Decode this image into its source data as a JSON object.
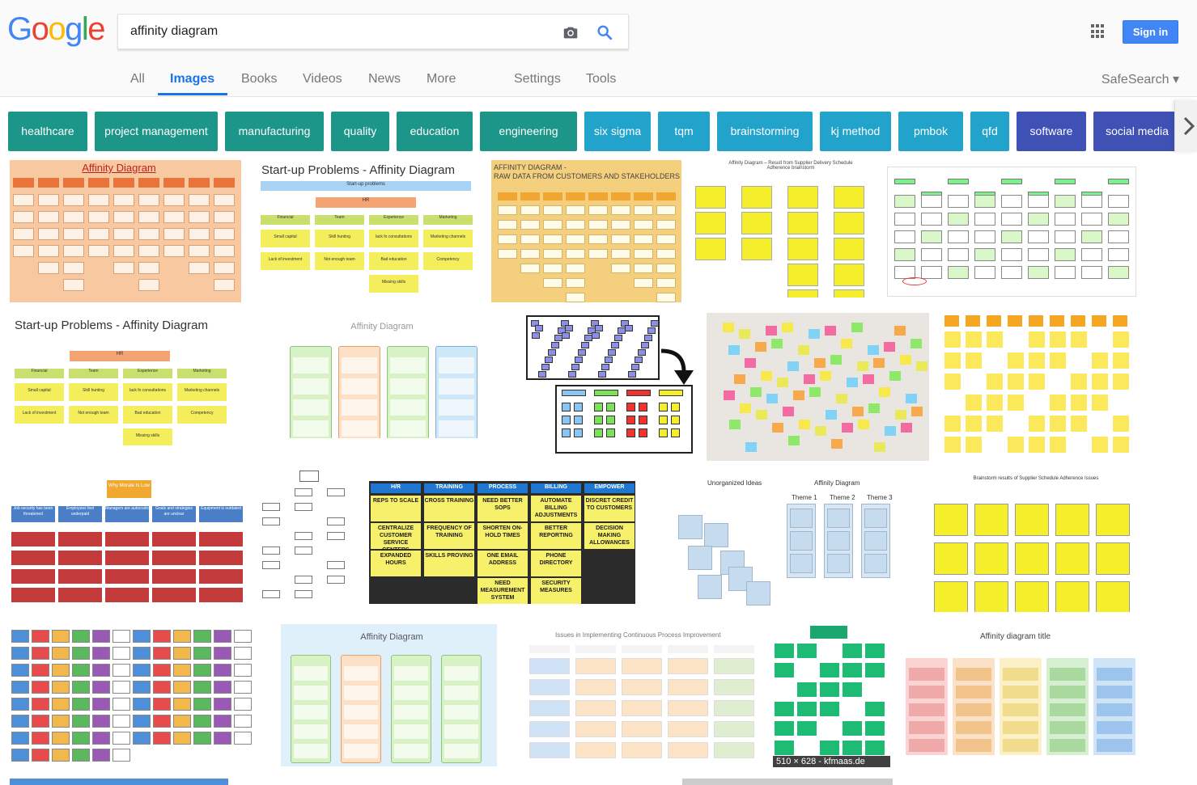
{
  "logo": {
    "letters": [
      "G",
      "o",
      "o",
      "g",
      "l",
      "e"
    ],
    "colors": [
      "#4285f4",
      "#ea4335",
      "#fbbc05",
      "#4285f4",
      "#34a853",
      "#ea4335"
    ]
  },
  "search": {
    "query": "affinity diagram",
    "placeholder": ""
  },
  "header": {
    "signin_label": "Sign in"
  },
  "nav": {
    "tabs": [
      "All",
      "Images",
      "Books",
      "Videos",
      "News",
      "More"
    ],
    "settings_label": "Settings",
    "tools_label": "Tools",
    "safesearch_label": "SafeSearch ▾",
    "active_tab": "Images"
  },
  "chips": [
    {
      "label": "healthcare",
      "color": "#1b9688"
    },
    {
      "label": "project management",
      "color": "#1b9688"
    },
    {
      "label": "manufacturing",
      "color": "#1b9688"
    },
    {
      "label": "quality",
      "color": "#1b9688"
    },
    {
      "label": "education",
      "color": "#1b9688"
    },
    {
      "label": "engineering",
      "color": "#1b9688"
    },
    {
      "label": "six sigma",
      "color": "#22a3cc"
    },
    {
      "label": "tqm",
      "color": "#22a3cc"
    },
    {
      "label": "brainstorming",
      "color": "#22a3cc"
    },
    {
      "label": "kj method",
      "color": "#22a3cc"
    },
    {
      "label": "pmbok",
      "color": "#22a3cc"
    },
    {
      "label": "qfd",
      "color": "#22a3cc"
    },
    {
      "label": "software",
      "color": "#3f51b5"
    },
    {
      "label": "social media",
      "color": "#3f51b5"
    }
  ],
  "results": {
    "r1_title": "Affinity Diagram",
    "r2_title": "Start-up Problems - Affinity Diagram",
    "r3_title": "AFFINITY DIAGRAM -\nRAW DATA FROM CUSTOMERS AND STAKEHOLDERS",
    "r4_title": "Affinity Diagram – Result from Supplier Delivery Schedule Adherence brainstorm",
    "r6_title": "Start-up Problems - Affinity Diagram",
    "r7_title": "Affinity Diagram",
    "r13_title": "Why Morale Is Low",
    "r16_left": "Unorganized Ideas",
    "r16_right": "Affinity Diagram",
    "r16_themes": [
      "Theme 1",
      "Theme 2",
      "Theme 3"
    ],
    "r17_title": "Brainstorm results of Supplier Schedule Adherence Issues",
    "r19_title": "Affinity Diagram",
    "r20_title": "Issues in Implementing Continuous Process Improvement",
    "r22_title": "Affinity diagram title",
    "size_badge": "510 × 628 - kfmaas.de"
  },
  "stickies": {
    "headers": [
      "H/R",
      "TRAINING",
      "PROCESS",
      "BILLING",
      "EMPOWER"
    ],
    "notes": [
      [
        "REPS TO SCALE",
        "CENTRALIZE CUSTOMER SERVICE CENTERS",
        "EXPANDED HOURS"
      ],
      [
        "CROSS TRAINING",
        "FREQUENCY OF TRAINING",
        "SKILLS PROVING"
      ],
      [
        "NEED BETTER SOPS",
        "SHORTEN ON-HOLD TIMES",
        "ONE EMAIL ADDRESS",
        "NEED MEASUREMENT SYSTEM"
      ],
      [
        "AUTOMATE BILLING ADJUSTMENTS",
        "BETTER REPORTING",
        "PHONE DIRECTORY",
        "SECURITY MEASURES"
      ],
      [
        "DISCRET CREDIT TO CUSTOMERS",
        "DECISION MAKING ALLOWANCES"
      ]
    ]
  },
  "startup": {
    "root": "Start-up problems",
    "hr": "HR",
    "columns": [
      {
        "head": "Financial",
        "items": [
          "Small capital",
          "Lack of investment"
        ]
      },
      {
        "head": "Team",
        "items": [
          "Skill hunting",
          "Not enough team"
        ]
      },
      {
        "head": "Experience",
        "items": [
          "lack fo consultations",
          "Bad education",
          "Missing skills"
        ]
      },
      {
        "head": "Marketing",
        "items": [
          "Marketing channels",
          "Competency"
        ]
      }
    ]
  },
  "morale": {
    "cats": [
      "Job security has been threatened",
      "Employees feel underpaid",
      "Managers are autocratic",
      "Goals and strategies are unclear",
      "Equipment is outdated"
    ]
  }
}
